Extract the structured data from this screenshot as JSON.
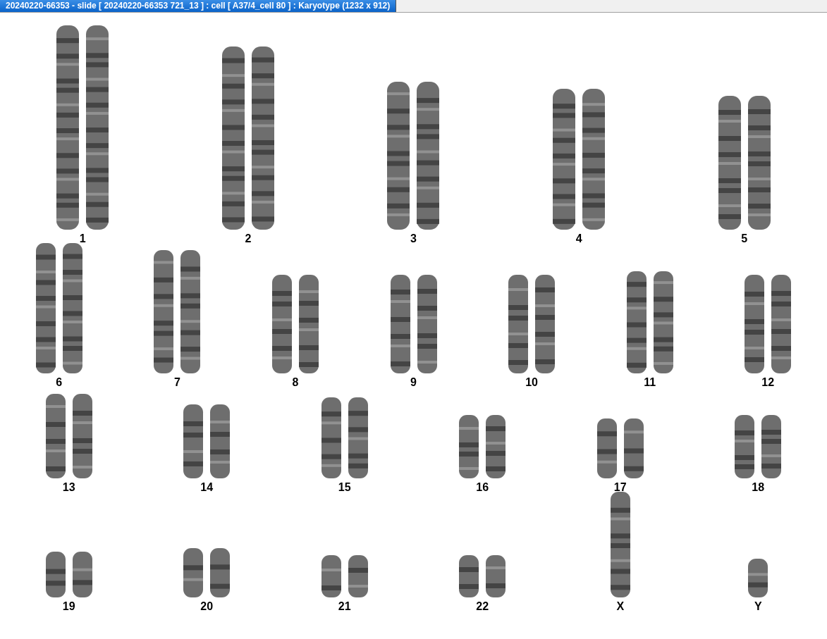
{
  "window": {
    "title": "20240220-66353 - slide [ 20240220-66353 721_13 ] : cell [ A37/4_cell 80 ] : Karyotype  (1232 x 912)"
  },
  "karyotype": {
    "rows": [
      [
        {
          "label": "1",
          "kind": "pair"
        },
        {
          "label": "2",
          "kind": "pair"
        },
        {
          "label": "3",
          "kind": "pair"
        },
        {
          "label": "4",
          "kind": "pair"
        },
        {
          "label": "5",
          "kind": "pair"
        }
      ],
      [
        {
          "label": "6",
          "kind": "pair"
        },
        {
          "label": "7",
          "kind": "pair"
        },
        {
          "label": "8",
          "kind": "pair"
        },
        {
          "label": "9",
          "kind": "pair"
        },
        {
          "label": "10",
          "kind": "pair"
        },
        {
          "label": "11",
          "kind": "pair"
        },
        {
          "label": "12",
          "kind": "pair"
        }
      ],
      [
        {
          "label": "13",
          "kind": "pair"
        },
        {
          "label": "14",
          "kind": "pair"
        },
        {
          "label": "15",
          "kind": "pair"
        },
        {
          "label": "16",
          "kind": "pair"
        },
        {
          "label": "17",
          "kind": "pair"
        },
        {
          "label": "18",
          "kind": "pair"
        }
      ],
      [
        {
          "label": "19",
          "kind": "pair"
        },
        {
          "label": "20",
          "kind": "pair"
        },
        {
          "label": "21",
          "kind": "pair"
        },
        {
          "label": "22",
          "kind": "pair"
        },
        {
          "label": "X",
          "kind": "single"
        },
        {
          "label": "Y",
          "kind": "single"
        }
      ]
    ]
  }
}
